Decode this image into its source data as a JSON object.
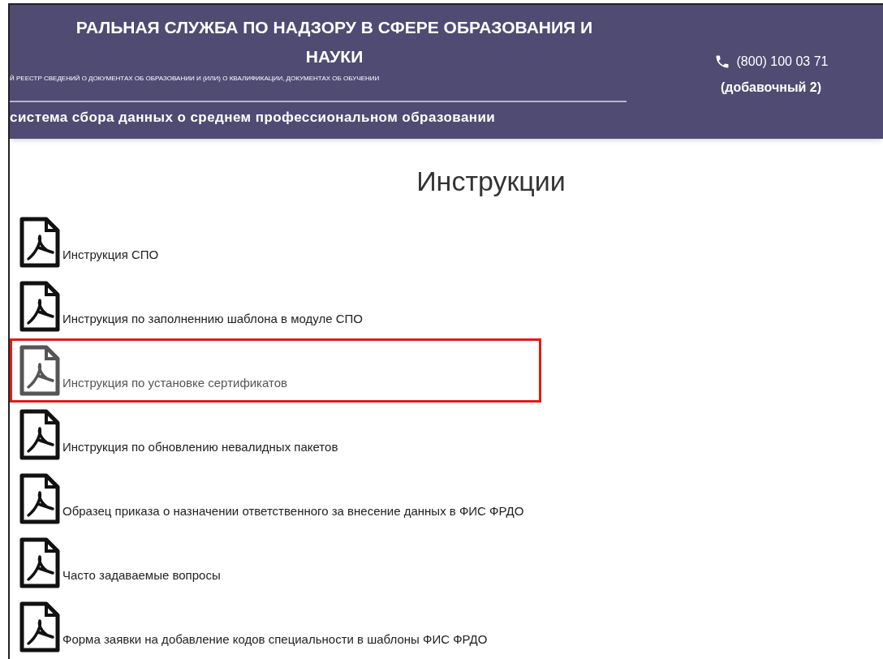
{
  "header": {
    "title_lines": [
      "РАЛЬНАЯ СЛУЖБА ПО НАДЗОРУ В СФЕРЕ ОБРАЗОВАНИЯ И",
      "НАУКИ"
    ],
    "subtitle": "Й РЕЕСТР СВЕДЕНИЙ О ДОКУМЕНТАХ ОБ ОБРАЗОВАНИИ И (ИЛИ) О КВАЛИФИКАЦИИ, ДОКУМЕНТАХ ОБ ОБУЧЕНИИ",
    "system_name": "система сбора данных о среднем профессиональном образовании",
    "phone": "(800) 100 03 71",
    "phone_note": "(добавочный 2)"
  },
  "page_title": "Инструкции",
  "documents": [
    {
      "label": "Инструкция СПО",
      "highlighted": false
    },
    {
      "label": "Инструкция по заполненнию шаблона в модуле СПО",
      "highlighted": false
    },
    {
      "label": "Инструкция по установке сертификатов",
      "highlighted": true
    },
    {
      "label": "Инструкция по обновлению невалидных пакетов",
      "highlighted": false
    },
    {
      "label": "Образец приказа о назначении ответственного за внесение данных в ФИС ФРДО",
      "highlighted": false
    },
    {
      "label": "Часто задаваемые вопросы",
      "highlighted": false
    },
    {
      "label": "Форма заявки на добавление кодов специальности в шаблоны ФИС ФРДО",
      "highlighted": false
    }
  ]
}
